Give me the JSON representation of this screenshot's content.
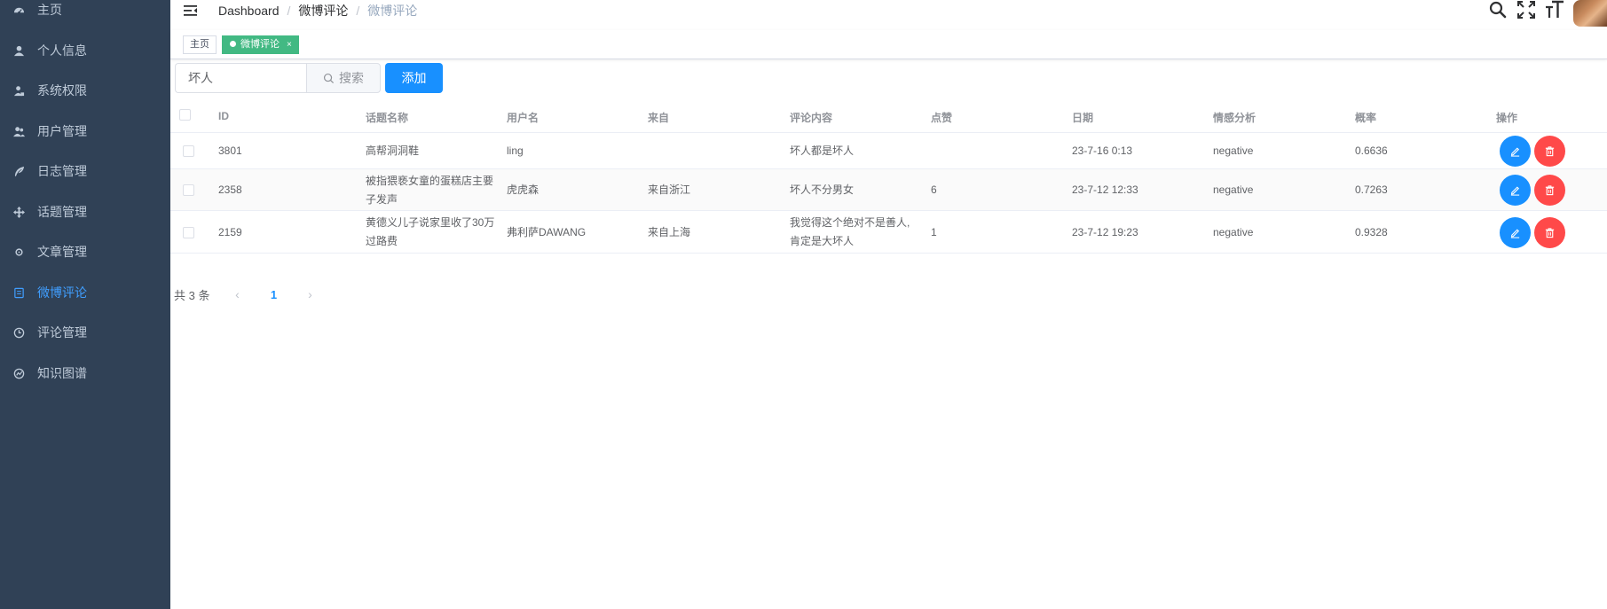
{
  "sidebar": {
    "items": [
      {
        "label": "主页",
        "icon": "dashboard-icon",
        "active": false
      },
      {
        "label": "个人信息",
        "icon": "user-icon",
        "active": false
      },
      {
        "label": "系统权限",
        "icon": "user-lock-icon",
        "active": false
      },
      {
        "label": "用户管理",
        "icon": "users-icon",
        "active": false
      },
      {
        "label": "日志管理",
        "icon": "feather-icon",
        "active": false
      },
      {
        "label": "话题管理",
        "icon": "move-arrows-icon",
        "active": false
      },
      {
        "label": "文章管理",
        "icon": "settings-icon",
        "active": false
      },
      {
        "label": "微博评论",
        "icon": "document-icon",
        "active": true
      },
      {
        "label": "评论管理",
        "icon": "clock-icon",
        "active": false
      },
      {
        "label": "知识图谱",
        "icon": "chart-circle-icon",
        "active": false
      }
    ]
  },
  "header": {
    "breadcrumb": [
      "Dashboard",
      "微博评论",
      "微博评论"
    ]
  },
  "tags": {
    "home": "主页",
    "active": "微博评论",
    "close": "×"
  },
  "toolbar": {
    "search_value": "坏人",
    "search_button": "搜索",
    "add_button": "添加"
  },
  "table": {
    "columns": [
      "ID",
      "话题名称",
      "用户名",
      "来自",
      "评论内容",
      "点赞",
      "日期",
      "情感分析",
      "概率",
      "操作"
    ],
    "rows": [
      {
        "id": "3801",
        "topic_lines": [
          "高帮洞洞鞋"
        ],
        "user": "ling",
        "from": "",
        "content_lines": [
          "坏人都是坏人"
        ],
        "likes": "",
        "date": "23-7-16 0:13",
        "sentiment": "negative",
        "prob": "0.6636"
      },
      {
        "id": "2358",
        "topic_lines": [
          "被指猥亵女童的蛋糕店主要",
          "子发声"
        ],
        "user": "虎虎森",
        "from": "来自浙江",
        "content_lines": [
          "坏人不分男女"
        ],
        "likes": "6",
        "date": "23-7-12 12:33",
        "sentiment": "negative",
        "prob": "0.7263"
      },
      {
        "id": "2159",
        "topic_lines": [
          "黄德义儿子说家里收了30万",
          "过路费"
        ],
        "user": "弗利萨DAWANG",
        "from": "来自上海",
        "content_lines": [
          "我觉得这个绝对不是善人,",
          "肯定是大坏人"
        ],
        "likes": "1",
        "date": "23-7-12 19:23",
        "sentiment": "negative",
        "prob": "0.9328"
      }
    ]
  },
  "pagination": {
    "total_text": "共 3 条",
    "current_page": "1",
    "prev": "‹",
    "next": "›"
  },
  "colors": {
    "sidebar_bg": "#304156",
    "sidebar_text": "#bfcbd9",
    "active": "#409eff",
    "primary": "#1890ff",
    "danger": "#ff4949",
    "tag_active": "#42b983"
  }
}
